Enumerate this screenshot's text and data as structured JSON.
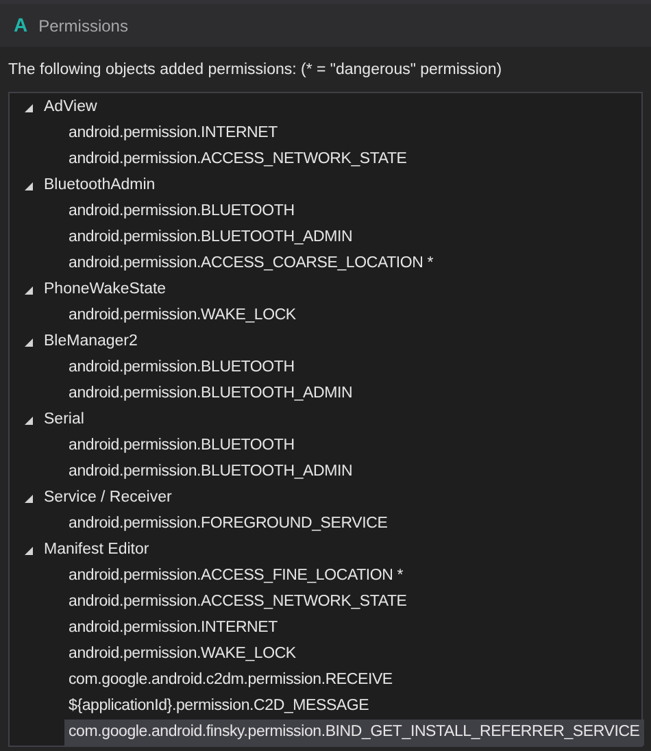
{
  "window": {
    "logo": "A",
    "title": "Permissions"
  },
  "description": "The following objects added permissions: (* = \"dangerous\" permission)",
  "tree": [
    {
      "label": "AdView",
      "expanded": true,
      "children": [
        {
          "label": "android.permission.INTERNET",
          "selected": false
        },
        {
          "label": "android.permission.ACCESS_NETWORK_STATE",
          "selected": false
        }
      ]
    },
    {
      "label": "BluetoothAdmin",
      "expanded": true,
      "children": [
        {
          "label": "android.permission.BLUETOOTH",
          "selected": false
        },
        {
          "label": "android.permission.BLUETOOTH_ADMIN",
          "selected": false
        },
        {
          "label": "android.permission.ACCESS_COARSE_LOCATION *",
          "selected": false
        }
      ]
    },
    {
      "label": "PhoneWakeState",
      "expanded": true,
      "children": [
        {
          "label": "android.permission.WAKE_LOCK",
          "selected": false
        }
      ]
    },
    {
      "label": "BleManager2",
      "expanded": true,
      "children": [
        {
          "label": "android.permission.BLUETOOTH",
          "selected": false
        },
        {
          "label": "android.permission.BLUETOOTH_ADMIN",
          "selected": false
        }
      ]
    },
    {
      "label": "Serial",
      "expanded": true,
      "children": [
        {
          "label": "android.permission.BLUETOOTH",
          "selected": false
        },
        {
          "label": "android.permission.BLUETOOTH_ADMIN",
          "selected": false
        }
      ]
    },
    {
      "label": "Service / Receiver",
      "expanded": true,
      "children": [
        {
          "label": "android.permission.FOREGROUND_SERVICE",
          "selected": false
        }
      ]
    },
    {
      "label": "Manifest Editor",
      "expanded": true,
      "children": [
        {
          "label": "android.permission.ACCESS_FINE_LOCATION *",
          "selected": false
        },
        {
          "label": "android.permission.ACCESS_NETWORK_STATE",
          "selected": false
        },
        {
          "label": "android.permission.INTERNET",
          "selected": false
        },
        {
          "label": "android.permission.WAKE_LOCK",
          "selected": false
        },
        {
          "label": "com.google.android.c2dm.permission.RECEIVE",
          "selected": false
        },
        {
          "label": "${applicationId}.permission.C2D_MESSAGE",
          "selected": false
        },
        {
          "label": "com.google.android.finsky.permission.BIND_GET_INSTALL_REFERRER_SERVICE",
          "selected": true
        }
      ]
    }
  ]
}
